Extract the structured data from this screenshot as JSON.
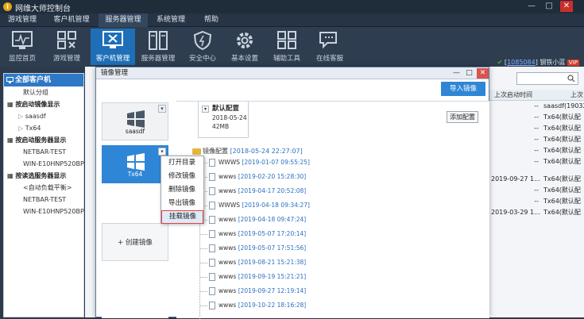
{
  "app": {
    "title": "网维大师控制台",
    "logo_glyph": "i"
  },
  "window_controls": {
    "minimize": "—",
    "maximize": "□",
    "close": "✕"
  },
  "menu": [
    "游戏管理",
    "客户机管理",
    "服务器管理",
    "系统管理",
    "帮助"
  ],
  "menu_active_index": 2,
  "toolbar": [
    {
      "label": "监控首页",
      "icon": "monitor-pulse-icon"
    },
    {
      "label": "游戏管理",
      "icon": "game-grid-icon"
    },
    {
      "label": "客户机管理",
      "icon": "client-monitor-icon",
      "active": true
    },
    {
      "label": "服务器管理",
      "icon": "server-icon"
    },
    {
      "label": "安全中心",
      "icon": "shield-icon"
    },
    {
      "label": "基本设置",
      "icon": "gear-icon"
    },
    {
      "label": "辅助工具",
      "icon": "tools-grid-icon"
    },
    {
      "label": "在线客服",
      "icon": "chat-icon"
    }
  ],
  "status": {
    "id": "1085084",
    "user": "钢铁小蓝",
    "badge": "VIP"
  },
  "sidebar": {
    "header": "全部客户机",
    "items": [
      {
        "label": "默认分组",
        "kind": "sub"
      },
      {
        "label": "按启动镜像显示",
        "kind": "group"
      },
      {
        "label": "saasdf",
        "kind": "leaf"
      },
      {
        "label": "Tx64",
        "kind": "leaf"
      },
      {
        "label": "按启动服务器显示",
        "kind": "group"
      },
      {
        "label": "NETBAR-TEST",
        "kind": "sub"
      },
      {
        "label": "WIN-E10HNP520BP",
        "kind": "sub"
      },
      {
        "label": "按读选服务器显示",
        "kind": "group"
      },
      {
        "label": "<自动负载平衡>",
        "kind": "sub"
      },
      {
        "label": "NETBAR-TEST",
        "kind": "sub"
      },
      {
        "label": "WIN-E10HNP520BP",
        "kind": "sub"
      }
    ]
  },
  "table": {
    "headers": [
      "上次启动时间",
      "上次"
    ],
    "rows": [
      {
        "time": "--",
        "image": "saasdf(19032"
      },
      {
        "time": "--",
        "image": "Tx64(默认配"
      },
      {
        "time": "--",
        "image": "Tx64(默认配"
      },
      {
        "time": "--",
        "image": "Tx64(默认配"
      },
      {
        "time": "--",
        "image": "Tx64(默认配"
      },
      {
        "time": "--",
        "image": "Tx64(默认配"
      },
      {
        "time": "2019-09-27 1...",
        "image": "Tx64(默认配"
      },
      {
        "time": "--",
        "image": "Tx64(默认配"
      },
      {
        "time": "--",
        "image": "Tx64(默认配"
      },
      {
        "time": "2019-03-29 1...",
        "image": "Tx64(默认配"
      }
    ]
  },
  "dialog": {
    "title": "镜像管理",
    "import_button": "导入镜像",
    "images": [
      {
        "name": "saasdf"
      },
      {
        "name": "Tx64",
        "selected": true
      }
    ],
    "create_label": "+ 创建镜像",
    "context_menu": [
      "打开目录",
      "修改镜像",
      "删除镜像",
      "导出镜像",
      "挂载镜像"
    ],
    "context_highlight_index": 4,
    "config_tab": {
      "title": "默认配置",
      "date": "2018-05-24",
      "size": "42MB"
    },
    "add_config_button": "添加配置",
    "tree_root": {
      "label": "镜像配置",
      "time": "[2018-05-24 22:27:07]"
    },
    "tree_rows": [
      {
        "name": "WWWS",
        "time": "[2019-01-07 09:55:25]"
      },
      {
        "name": "wwws",
        "time": "[2019-02-20 15:28:30]"
      },
      {
        "name": "wwws",
        "time": "[2019-04-17 20:52:08]"
      },
      {
        "name": "WWWS",
        "time": "[2019-04-18 09:34:27]"
      },
      {
        "name": "wwws",
        "time": "[2019-04-18 09:47:24]"
      },
      {
        "name": "wwws",
        "time": "[2019-05-07 17:20:14]"
      },
      {
        "name": "wwws",
        "time": "[2019-05-07 17:51:56]"
      },
      {
        "name": "wwws",
        "time": "[2019-08-21 15:21:38]"
      },
      {
        "name": "wwws",
        "time": "[2019-09-19 15:21:21]"
      },
      {
        "name": "wwws",
        "time": "[2019-09-27 12:19:14]"
      },
      {
        "name": "wwws",
        "time": "[2019-10-22 18:16:28]"
      }
    ]
  },
  "colors": {
    "accent": "#2f86d6",
    "titlebar": "#1f2c3a",
    "toolbar": "#2e3d4f"
  }
}
